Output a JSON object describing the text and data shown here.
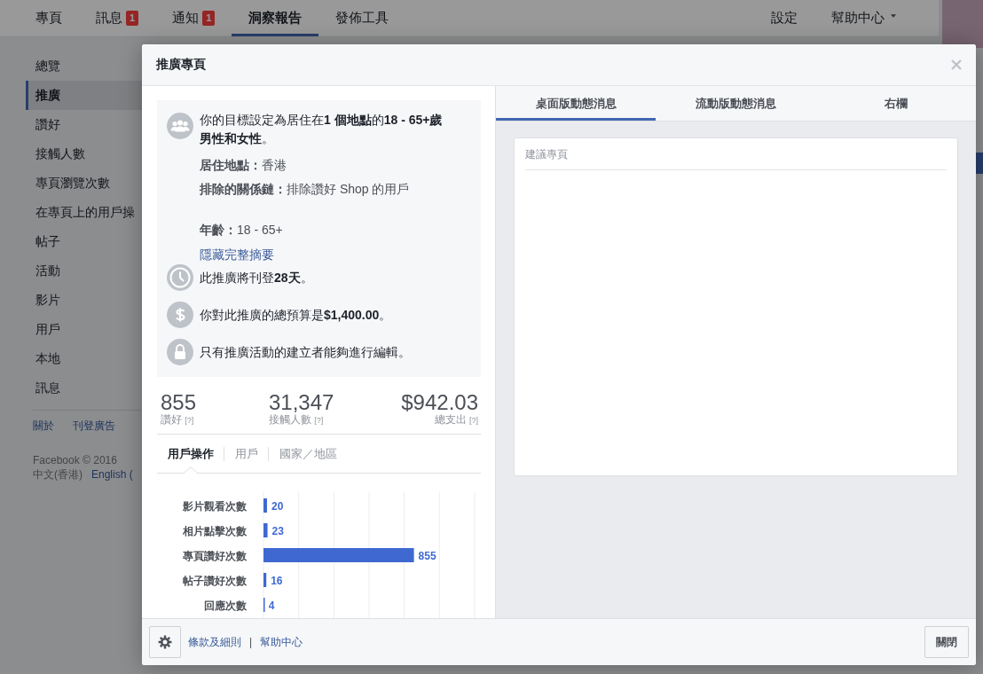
{
  "nav": {
    "items": [
      {
        "label": "專頁",
        "selected": false
      },
      {
        "label": "訊息",
        "badge": "1",
        "selected": false
      },
      {
        "label": "通知",
        "badge": "1",
        "selected": false
      },
      {
        "label": "洞察報告",
        "selected": true
      },
      {
        "label": "發佈工具",
        "selected": false
      }
    ],
    "right": [
      {
        "label": "設定",
        "dropdown": false
      },
      {
        "label": "幫助中心",
        "dropdown": true
      }
    ]
  },
  "sidebar": {
    "items": [
      {
        "label": "總覽",
        "selected": false
      },
      {
        "label": "推廣",
        "selected": true
      },
      {
        "label": "讚好",
        "selected": false
      },
      {
        "label": "接觸人數",
        "selected": false
      },
      {
        "label": "專頁瀏覽次數",
        "selected": false
      },
      {
        "label": "在專頁上的用戶操",
        "selected": false
      },
      {
        "label": "帖子",
        "selected": false
      },
      {
        "label": "活動",
        "selected": false
      },
      {
        "label": "影片",
        "selected": false
      },
      {
        "label": "用戶",
        "selected": false
      },
      {
        "label": "本地",
        "selected": false
      },
      {
        "label": "訊息",
        "selected": false
      }
    ],
    "links": [
      "關於",
      "刊登廣告"
    ],
    "copyright": "Facebook © 2016",
    "languages": [
      {
        "label": "中文(香港)",
        "current": true
      },
      {
        "label": "English (",
        "current": false
      }
    ]
  },
  "modal": {
    "title": "推廣專頁",
    "summary": {
      "audience": "你的目標設定為居住在**1 個地點**的**18 - 65+歲男性和女性**。",
      "detail_groups": [
        [
          "**居住地點：**香港",
          "**排除的關係鏈：**排除讚好 Shop 的用戶"
        ],
        [
          "**年齡：**18 - 65+"
        ]
      ],
      "toggle_link": "隱藏完整摘要",
      "facts": [
        {
          "kind": "duration",
          "text": "此推廣將刊登**28天**。"
        },
        {
          "kind": "budget",
          "text": "你對此推廣的總預算是**$1,400.00**。"
        },
        {
          "kind": "permission",
          "text": "只有推廣活動的建立者能夠進行編輯。"
        }
      ]
    },
    "stats": [
      {
        "value": "855",
        "label": "讚好",
        "help": "[?]"
      },
      {
        "value": "31,347",
        "label": "接觸人數",
        "help": "[?]"
      },
      {
        "value": "$942.03",
        "label": "總支出",
        "help": "[?]"
      }
    ],
    "tabs": [
      {
        "label": "用戶操作",
        "selected": true
      },
      {
        "label": "用戶",
        "selected": false
      },
      {
        "label": "國家／地區",
        "selected": false
      }
    ],
    "chart_data": {
      "type": "bar",
      "orientation": "horizontal",
      "categories": [
        "影片觀看次數",
        "相片點擊次數",
        "專頁讚好次數",
        "帖子讚好次數",
        "回應次數"
      ],
      "values": [
        20,
        23,
        855,
        16,
        4
      ],
      "xlim": [
        0,
        1200
      ],
      "data_labels": true
    },
    "preview": {
      "tabs": [
        {
          "label": "桌面版動態消息",
          "selected": true
        },
        {
          "label": "流動版動態消息",
          "selected": false
        },
        {
          "label": "右欄",
          "selected": false
        }
      ],
      "card_title": "建議專頁"
    },
    "footer": {
      "links": [
        "條款及細則",
        "幫助中心"
      ],
      "separator": "|",
      "close_button": "關閉"
    }
  }
}
